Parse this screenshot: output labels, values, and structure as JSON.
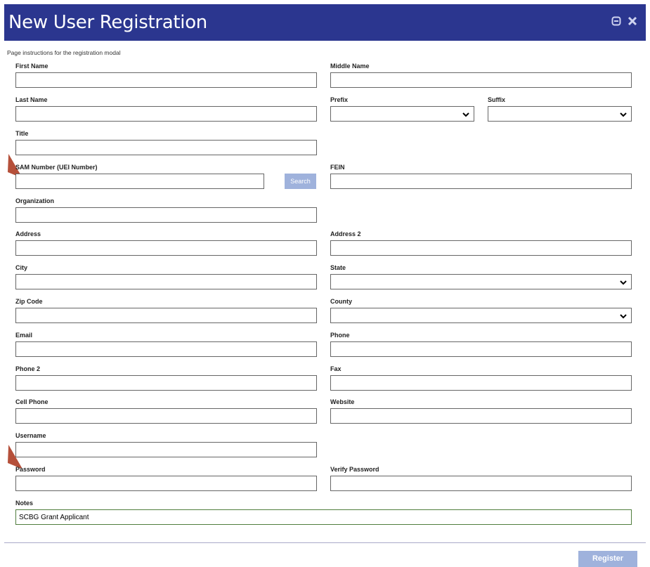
{
  "window": {
    "title": "New User Registration",
    "minimize_icon": "minimize-icon",
    "close_icon": "close-icon"
  },
  "instructions": "Page instructions for the registration modal",
  "fields": {
    "first_name": {
      "label": "First Name",
      "value": ""
    },
    "middle_name": {
      "label": "Middle Name",
      "value": ""
    },
    "last_name": {
      "label": "Last Name",
      "value": ""
    },
    "prefix": {
      "label": "Prefix",
      "value": ""
    },
    "suffix": {
      "label": "Suffix",
      "value": ""
    },
    "title": {
      "label": "Title",
      "value": ""
    },
    "sam_number": {
      "label": "SAM Number (UEI Number)",
      "value": ""
    },
    "fein": {
      "label": "FEIN",
      "value": ""
    },
    "organization": {
      "label": "Organization",
      "value": ""
    },
    "address": {
      "label": "Address",
      "value": ""
    },
    "address2": {
      "label": "Address 2",
      "value": ""
    },
    "city": {
      "label": "City",
      "value": ""
    },
    "state": {
      "label": "State",
      "value": ""
    },
    "zip": {
      "label": "Zip Code",
      "value": ""
    },
    "county": {
      "label": "County",
      "value": ""
    },
    "email": {
      "label": "Email",
      "value": ""
    },
    "phone": {
      "label": "Phone",
      "value": ""
    },
    "phone2": {
      "label": "Phone 2",
      "value": ""
    },
    "fax": {
      "label": "Fax",
      "value": ""
    },
    "cell_phone": {
      "label": "Cell Phone",
      "value": ""
    },
    "website": {
      "label": "Website",
      "value": ""
    },
    "username": {
      "label": "Username",
      "value": ""
    },
    "password": {
      "label": "Password",
      "value": ""
    },
    "verify_password": {
      "label": "Verify Password",
      "value": ""
    },
    "notes": {
      "label": "Notes",
      "value": "SCBG Grant Applicant"
    }
  },
  "buttons": {
    "search": "Search",
    "register": "Register"
  },
  "colors": {
    "titlebar": "#2b368f",
    "button": "#9fb2dc",
    "arrow": "#b5503a",
    "notes_border": "#4f7d3c"
  }
}
